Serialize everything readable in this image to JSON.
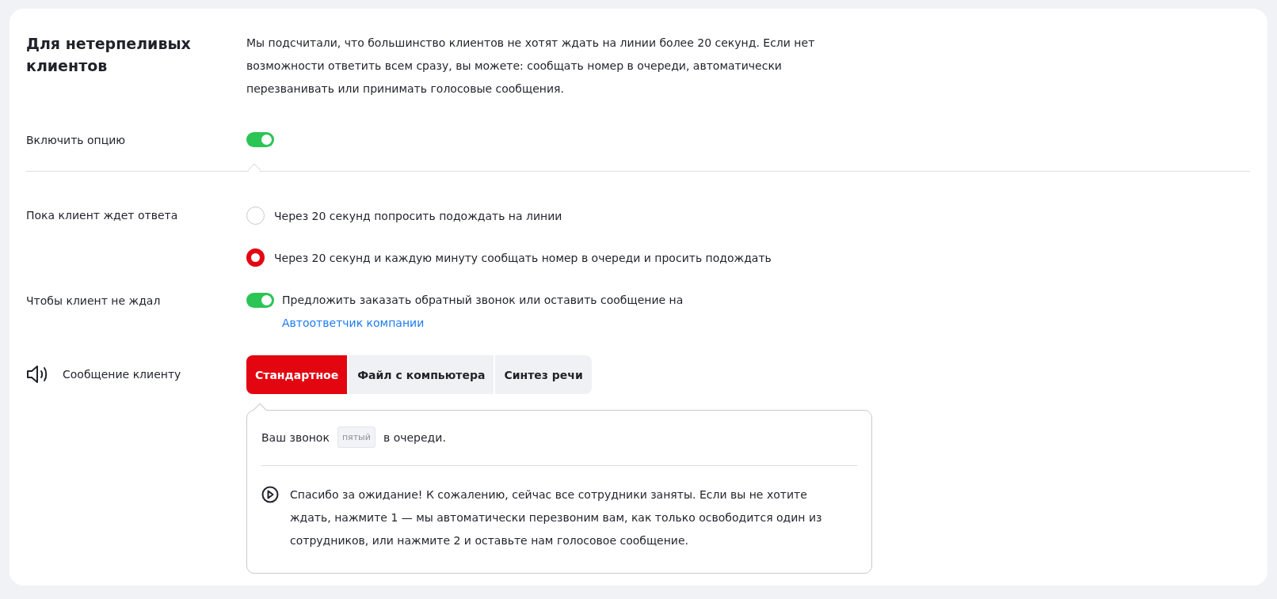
{
  "section": {
    "title": "Для нетерпеливых клиентов",
    "description": "Мы подсчитали, что большинство клиентов не хотят ждать на линии более 20 секунд. Если нет возможности ответить всем сразу, вы можете: сообщать номер в очереди, автоматически перезванивать или принимать голосовые сообщения."
  },
  "enable": {
    "label": "Включить опцию",
    "on": true
  },
  "waiting": {
    "label": "Пока клиент ждет ответа",
    "options": [
      {
        "label": "Через 20 секунд попросить подождать на линии",
        "selected": false
      },
      {
        "label": "Через 20 секунд и каждую минуту сообщать номер в очереди и просить подождать",
        "selected": true
      }
    ]
  },
  "no_wait": {
    "label": "Чтобы клиент не ждал",
    "on": true,
    "text": "Предложить заказать обратный звонок или оставить сообщение на",
    "link": "Автоответчик компании"
  },
  "message": {
    "label": "Сообщение клиенту",
    "tabs": [
      {
        "label": "Стандартное",
        "selected": true
      },
      {
        "label": "Файл с компьютера",
        "selected": false
      },
      {
        "label": "Синтез речи",
        "selected": false
      }
    ],
    "queue_before": "Ваш звонок",
    "queue_tag": "пятый",
    "queue_after": "в очереди.",
    "text": "Спасибо за ожидание! К сожалению, сейчас все сотрудники заняты. Если вы не хотите ждать, нажмите 1 — мы автоматически перезвоним вам, как только освободится один из сотрудников, или нажмите 2 и оставьте нам голосовое сообщение."
  }
}
